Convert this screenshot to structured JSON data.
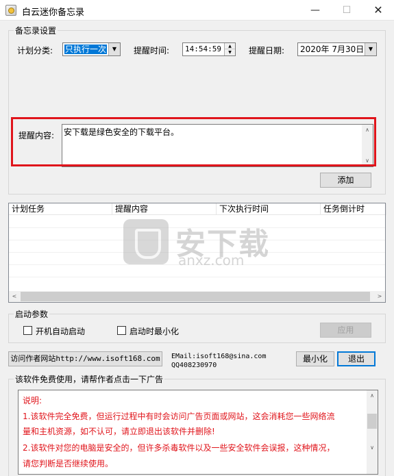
{
  "window": {
    "title": "白云迷你备忘录",
    "minimize_glyph": "—",
    "maximize_glyph": "☐",
    "close_glyph": "✕"
  },
  "memo_settings": {
    "group_title": "备忘录设置",
    "category_label": "计划分类:",
    "category_value": "只执行一次",
    "time_label": "提醒时间:",
    "time_value": "14:54:59",
    "date_label": "提醒日期:",
    "date_value": "2020年 7月30日",
    "content_label": "提醒内容:",
    "content_value": "安下载是绿色安全的下载平台。",
    "add_button": "添加"
  },
  "task_list": {
    "columns": [
      "计划任务",
      "提醒内容",
      "下次执行时间",
      "任务倒计时"
    ],
    "rows": []
  },
  "watermark": {
    "brand": "安下载",
    "url": "anxz.com"
  },
  "startup": {
    "group_title": "启动参数",
    "autostart_label": "开机自动启动",
    "autostart_checked": false,
    "minimize_on_start_label": "启动时最小化",
    "minimize_on_start_checked": false,
    "apply_button": "应用"
  },
  "footer": {
    "visit_button": "访问作者网站http://www.isoft168.com",
    "email_line": "EMail:isoft168@sina.com",
    "qq_line": "QQ408230970",
    "minimize_button": "最小化",
    "exit_button": "退出"
  },
  "ad": {
    "title": "该软件免费使用，请帮作者点击一下广告",
    "lines": [
      "说明:",
      "1.该软件完全免费，但运行过程中有时会访问广告页面或网站，这会消耗您一些网络流",
      "量和主机资源，如不认可，请立即退出该软件并删除!",
      "2.该软件对您的电脑是安全的，但许多杀毒软件以及一些安全软件会误报，这种情况，",
      "请您判断是否继续使用。"
    ],
    "text_color": "#e0141b"
  },
  "colors": {
    "highlight_border": "#e0141b",
    "selection": "#0078d7",
    "window_bg": "#f0f0f0"
  }
}
